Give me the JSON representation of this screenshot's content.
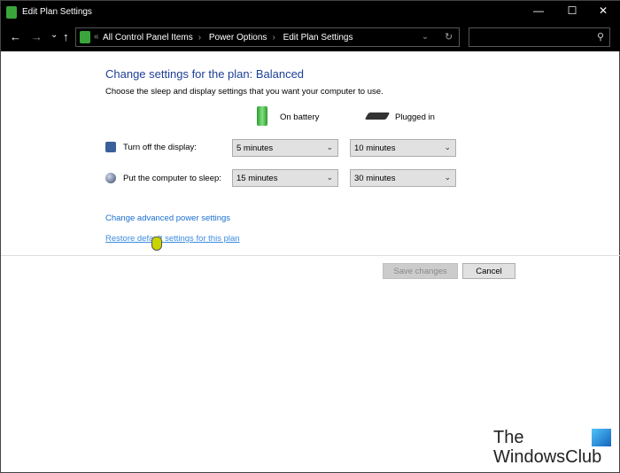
{
  "window": {
    "title": "Edit Plan Settings",
    "minimize": "—",
    "maximize": "☐",
    "close": "✕"
  },
  "nav": {
    "back": "←",
    "forward": "→",
    "recent": "⌄",
    "up": "↑",
    "breadcrumb": [
      "All Control Panel Items",
      "Power Options",
      "Edit Plan Settings"
    ],
    "overflow": "«",
    "dropdown": "⌄",
    "refresh": "↻",
    "search_placeholder": "",
    "search_icon": "⚲"
  },
  "main": {
    "title": "Change settings for the plan: Balanced",
    "subtitle": "Choose the sleep and display settings that you want your computer to use.",
    "columns": [
      "On battery",
      "Plugged in"
    ],
    "rows": [
      {
        "label": "Turn off the display:",
        "icon": "display-icon",
        "on_battery": "5 minutes",
        "plugged_in": "10 minutes"
      },
      {
        "label": "Put the computer to sleep:",
        "icon": "sleep-icon",
        "on_battery": "15 minutes",
        "plugged_in": "30 minutes"
      }
    ],
    "links": {
      "advanced": "Change advanced power settings",
      "restore": "Restore default settings for this plan"
    },
    "buttons": {
      "save": "Save changes",
      "cancel": "Cancel"
    }
  },
  "watermark": {
    "line1": "The",
    "line2": "WindowsClub"
  },
  "colors": {
    "heading": "#1e3f95",
    "link": "#1a6fcf"
  }
}
